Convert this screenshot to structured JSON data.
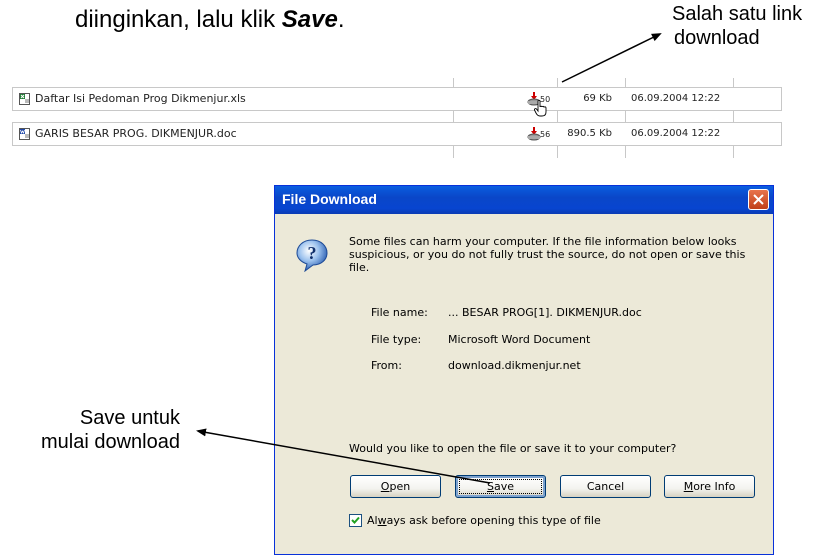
{
  "instruction": {
    "text_before": "diinginkan, lalu klik ",
    "emphasis": "Save",
    "text_after": "."
  },
  "annotations": {
    "link_note_line1": "Salah satu link",
    "link_note_line2": "download",
    "save_note_line1": "Save untuk",
    "save_note_line2": "mulai download"
  },
  "file_list": {
    "rows": [
      {
        "name": "Daftar Isi Pedoman Prog Dikmenjur.xls",
        "icon": "excel-file-icon",
        "download_count": "50",
        "size": "69 Kb",
        "date": "06.09.2004 12:22"
      },
      {
        "name": "GARIS BESAR PROG. DIKMENJUR.doc",
        "icon": "word-file-icon",
        "download_count": "56",
        "size": "890.5 Kb",
        "date": "06.09.2004 12:22"
      }
    ]
  },
  "dialog": {
    "title": "File Download",
    "message": "Some files can harm your computer. If the file information below looks suspicious, or you do not fully trust the source, do not open or save this file.",
    "file_name_label": "File name:",
    "file_name_value": "... BESAR PROG[1]. DIKMENJUR.doc",
    "file_type_label": "File type:",
    "file_type_value": "Microsoft Word Document",
    "from_label": "From:",
    "from_value": "download.dikmenjur.net",
    "question": "Would you like to open the file or save it to your computer?",
    "buttons": {
      "open": {
        "accel": "O",
        "rest": "pen"
      },
      "save": {
        "accel": "S",
        "rest": "ave"
      },
      "cancel": "Cancel",
      "more_info": {
        "accel": "M",
        "rest": "ore Info"
      }
    },
    "checkbox": {
      "before": "Al",
      "accel": "w",
      "after": "ays ask before opening this type of file",
      "checked": true
    },
    "colors": {
      "titlebar": "#0a46c8",
      "body": "#ece9d8",
      "close": "#d9542b"
    }
  }
}
